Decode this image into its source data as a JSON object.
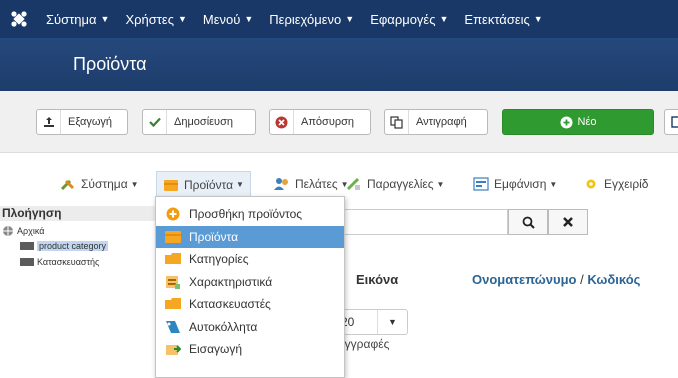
{
  "topbar": {
    "logo_icon": "joomla-logo-icon",
    "items": [
      {
        "label": "Σύστημα"
      },
      {
        "label": "Χρήστες"
      },
      {
        "label": "Μενού"
      },
      {
        "label": "Περιεχόμενο"
      },
      {
        "label": "Εφαρμογές"
      },
      {
        "label": "Επεκτάσεις"
      }
    ]
  },
  "page_title": "Προϊόντα",
  "toolbar": {
    "export_label": "Εξαγωγή",
    "publish_label": "Δημοσίευση",
    "unpublish_label": "Απόσυρση",
    "copy_label": "Αντιγραφή",
    "new_label": "Νέο",
    "new_color": "#2f9a2f"
  },
  "component_menu": {
    "items": [
      {
        "label": "Σύστημα"
      },
      {
        "label": "Προϊόντα"
      },
      {
        "label": "Πελάτες"
      },
      {
        "label": "Παραγγελίες"
      },
      {
        "label": "Εμφάνιση"
      },
      {
        "label": "Εγχειρίδ"
      }
    ]
  },
  "sidebar": {
    "heading": "Πλοήγηση",
    "root_label": "Αρχικά",
    "children": [
      {
        "label": "product category",
        "selected": true
      },
      {
        "label": "Κατασκευαστής",
        "selected": false
      }
    ]
  },
  "dropdown": {
    "items": [
      {
        "label": "Προσθήκη προϊόντος",
        "icon": "plus-circle-icon"
      },
      {
        "label": "Προϊόντα",
        "icon": "folder-icon",
        "active": true
      },
      {
        "label": "Κατηγορίες",
        "icon": "folder-open-icon"
      },
      {
        "label": "Χαρακτηριστικά",
        "icon": "attributes-icon"
      },
      {
        "label": "Κατασκευαστές",
        "icon": "folder-open-icon"
      },
      {
        "label": "Αυτοκόλλητα",
        "icon": "label-icon"
      },
      {
        "label": "Εισαγωγή",
        "icon": "import-icon"
      }
    ]
  },
  "list": {
    "col_image": "Εικόνα",
    "col_name": "Ονοματεπώνυμο",
    "col_sep": " / ",
    "col_code": "Κωδικός",
    "limit_value": "20",
    "limit_note": "ν εγγραφές"
  },
  "colors": {
    "topbar": "#1a3867",
    "titlebar": "#25487c",
    "active_item": "#5a9bd5",
    "link": "#2a6496"
  }
}
